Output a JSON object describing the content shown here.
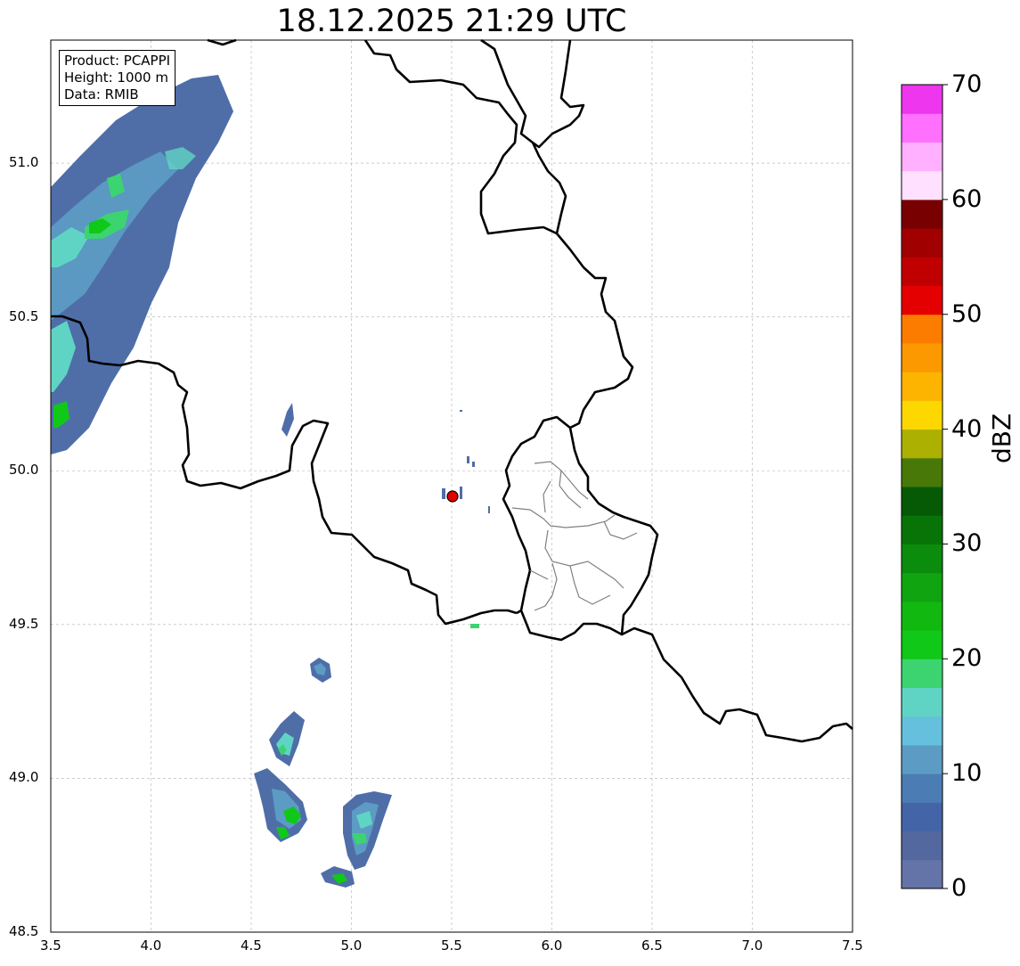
{
  "title": "18.12.2025 21:29 UTC",
  "info_box": {
    "product": "Product: PCAPPI",
    "height": "Height: 1000 m",
    "data": "Data: RMIB"
  },
  "map": {
    "lon_range": [
      3.5,
      7.5
    ],
    "lat_range": [
      48.5,
      51.4
    ],
    "x_ticks": [
      "3.5",
      "4.0",
      "4.5",
      "5.0",
      "5.5",
      "6.0",
      "6.5",
      "7.0",
      "7.5"
    ],
    "y_ticks": [
      "48.5",
      "49.0",
      "49.5",
      "50.0",
      "50.5",
      "51.0"
    ],
    "grid": true,
    "radar_site": {
      "lon": 5.51,
      "lat": 49.92,
      "color": "#e00000"
    },
    "border_color": "#000000",
    "district_color": "#808080"
  },
  "colorbar": {
    "label": "dBZ",
    "min": 0,
    "max": 70,
    "ticks": [
      "0",
      "10",
      "20",
      "30",
      "40",
      "50",
      "60",
      "70"
    ],
    "colors": [
      "#6474a8",
      "#5468a0",
      "#4464a8",
      "#4c7cb4",
      "#5c9cc4",
      "#64c0dc",
      "#60d4c4",
      "#3cd470",
      "#10c818",
      "#10b810",
      "#10a410",
      "#0c8c0c",
      "#087408",
      "#065a06",
      "#487808",
      "#acb000",
      "#fcd800",
      "#fcb400",
      "#fc9800",
      "#fc7c00",
      "#e40000",
      "#c00000",
      "#a00000",
      "#780000",
      "#ffe0ff",
      "#ffb0ff",
      "#ff70ff",
      "#ee36ee"
    ]
  }
}
